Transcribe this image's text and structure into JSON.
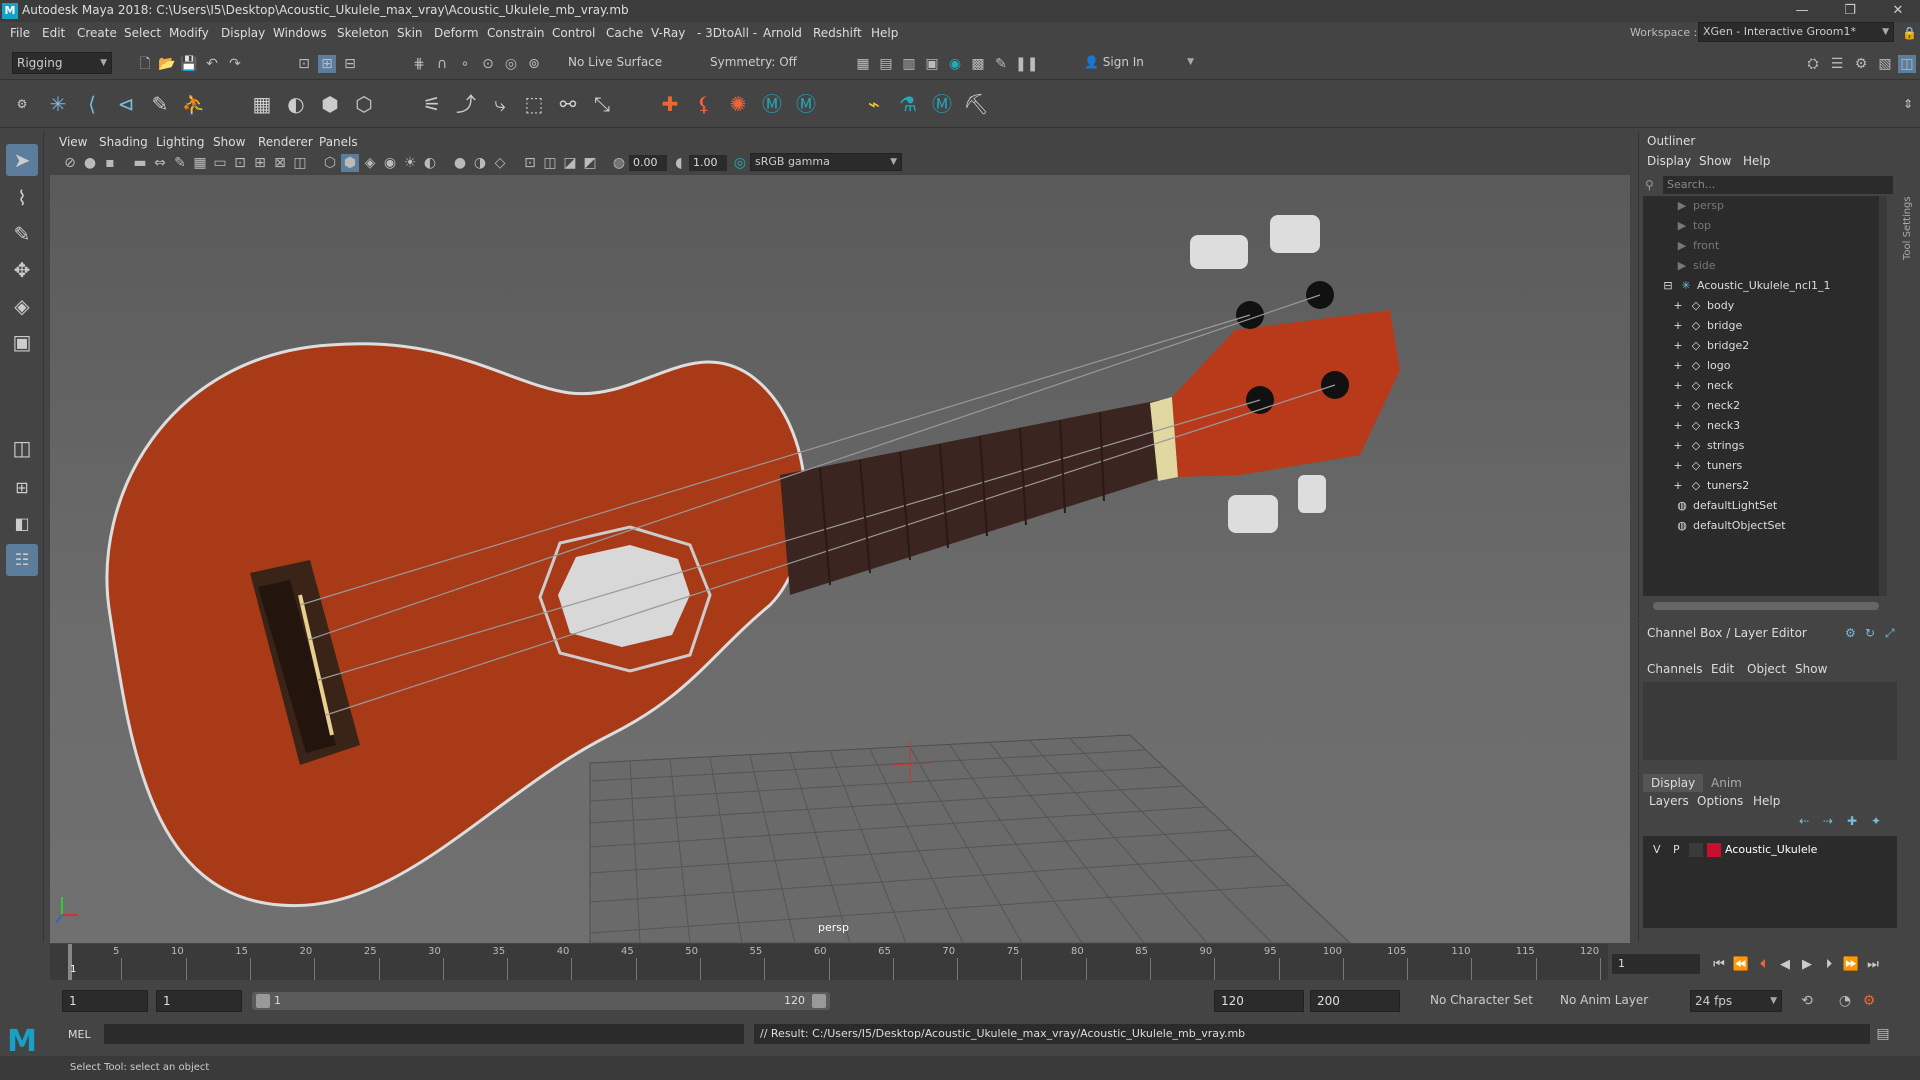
{
  "window": {
    "title": "Autodesk Maya 2018: C:\\Users\\I5\\Desktop\\Acoustic_Ukulele_max_vray\\Acoustic_Ukulele_mb_vray.mb",
    "logo": "M",
    "minimize": "—",
    "restore": "❐",
    "close": "✕"
  },
  "menubar": [
    "File",
    "Edit",
    "Create",
    "Select",
    "Modify",
    "Display",
    "Windows",
    "Skeleton",
    "Skin",
    "Deform",
    "Constrain",
    "Control",
    "Cache",
    "V-Ray",
    "- 3DtoAll -",
    "Arnold",
    "Redshift",
    "Help"
  ],
  "workspace": {
    "label": "Workspace :",
    "value": "XGen - Interactive Groom1*"
  },
  "statusline": {
    "mode": "Rigging",
    "live_surface": "No Live Surface",
    "symmetry": "Symmetry: Off",
    "sign_in": "Sign In"
  },
  "viewport_menu": [
    "View",
    "Shading",
    "Lighting",
    "Show",
    "Renderer",
    "Panels"
  ],
  "viewport_toolbar": {
    "exposure": "0.00",
    "gamma": "1.00",
    "color_space": "sRGB gamma"
  },
  "viewport": {
    "camera_label": "persp"
  },
  "outliner": {
    "title": "Outliner",
    "menu": [
      "Display",
      "Show",
      "Help"
    ],
    "search_placeholder": "Search...",
    "items": [
      {
        "label": "persp",
        "kind": "camera",
        "indent": 2
      },
      {
        "label": "top",
        "kind": "camera",
        "indent": 2
      },
      {
        "label": "front",
        "kind": "camera",
        "indent": 2
      },
      {
        "label": "side",
        "kind": "camera",
        "indent": 2
      },
      {
        "label": "Acoustic_Ukulele_ncl1_1",
        "kind": "group",
        "indent": 1
      },
      {
        "label": "body",
        "kind": "mesh",
        "indent": 3
      },
      {
        "label": "bridge",
        "kind": "mesh",
        "indent": 3
      },
      {
        "label": "bridge2",
        "kind": "mesh",
        "indent": 3
      },
      {
        "label": "logo",
        "kind": "mesh",
        "indent": 3
      },
      {
        "label": "neck",
        "kind": "mesh",
        "indent": 3
      },
      {
        "label": "neck2",
        "kind": "mesh",
        "indent": 3
      },
      {
        "label": "neck3",
        "kind": "mesh",
        "indent": 3
      },
      {
        "label": "strings",
        "kind": "mesh",
        "indent": 3
      },
      {
        "label": "tuners",
        "kind": "mesh",
        "indent": 3
      },
      {
        "label": "tuners2",
        "kind": "mesh",
        "indent": 3
      },
      {
        "label": "defaultLightSet",
        "kind": "set",
        "indent": 1
      },
      {
        "label": "defaultObjectSet",
        "kind": "set",
        "indent": 1
      }
    ]
  },
  "channel_box": {
    "title": "Channel Box / Layer Editor",
    "menu": [
      "Channels",
      "Edit",
      "Object",
      "Show"
    ]
  },
  "layer_editor": {
    "tabs": [
      "Display",
      "Anim"
    ],
    "menu": [
      "Layers",
      "Options",
      "Help"
    ],
    "layer": {
      "visible": "V",
      "playback": "P",
      "name": "Acoustic_Ukulele",
      "color": "#c8102e"
    }
  },
  "timeslider": {
    "ticks": [
      "5",
      "10",
      "15",
      "20",
      "25",
      "30",
      "35",
      "40",
      "45",
      "50",
      "55",
      "60",
      "65",
      "70",
      "75",
      "80",
      "85",
      "90",
      "95",
      "100",
      "105",
      "110",
      "115",
      "120"
    ],
    "current_marker": "1",
    "current_frame": "1"
  },
  "range": {
    "start": "1",
    "anim_start": "1",
    "slider_start": "1",
    "slider_end": "120",
    "end": "120",
    "anim_end": "200",
    "character_set": "No Character Set",
    "anim_layer": "No Anim Layer",
    "fps": "24 fps"
  },
  "command": {
    "lang": "MEL",
    "result": "// Result: C:/Users/I5/Desktop/Acoustic_Ukulele_max_vray/Acoustic_Ukulele_mb_vray.mb"
  },
  "help_line": "Select Tool: select an object",
  "side_tab": "Tool Settings",
  "colors": {
    "accent": "#5d7d9c",
    "ukulele_body": "#a83a18",
    "fretboard": "#3a2520"
  }
}
